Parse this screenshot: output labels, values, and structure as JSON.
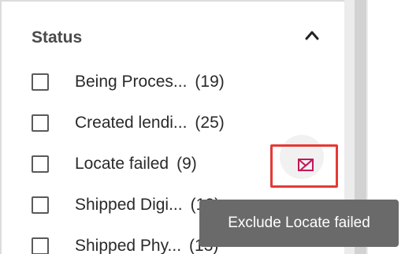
{
  "filter": {
    "title": "Status",
    "collapse_icon": "chevron-up-icon",
    "items": [
      {
        "label": "Being Proces...",
        "count": "(19)",
        "checked": false
      },
      {
        "label": "Created lendi...",
        "count": "(25)",
        "checked": false
      },
      {
        "label": "Locate failed",
        "count": "(9)",
        "checked": false
      },
      {
        "label": "Shipped Digi...",
        "count": "(12)",
        "checked": false
      },
      {
        "label": "Shipped Phy...",
        "count": "(13)",
        "checked": false
      }
    ]
  },
  "exclude_button": {
    "icon": "exclude-mail-icon",
    "highlight_color": "#e53935",
    "icon_color": "#c2185b"
  },
  "tooltip": {
    "text": "Exclude Locate failed"
  }
}
